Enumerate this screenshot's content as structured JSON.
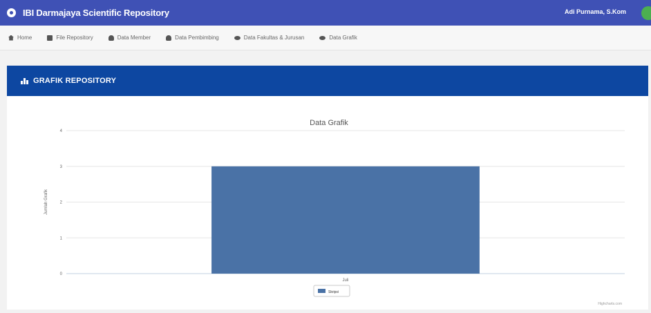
{
  "header": {
    "app_title": "IBI Darmajaya Scientific Repository",
    "user_name": "Adi Purnama, S.Kom"
  },
  "nav": {
    "items": [
      {
        "label": "Home",
        "icon": "home-icon"
      },
      {
        "label": "File Repository",
        "icon": "file-icon"
      },
      {
        "label": "Data Member",
        "icon": "user-icon"
      },
      {
        "label": "Data Pembimbing",
        "icon": "user-icon"
      },
      {
        "label": "Data Fakultas & Jurusan",
        "icon": "eye-icon"
      },
      {
        "label": "Data Grafik",
        "icon": "eye-icon"
      }
    ]
  },
  "panel": {
    "title": "GRAFIK REPOSITORY"
  },
  "chart_data": {
    "type": "bar",
    "title": "Data Grafik",
    "ylabel": "Jumlah Grafik",
    "xlabel": "",
    "categories": [
      "Juli"
    ],
    "series": [
      {
        "name": "Skripsi",
        "values": [
          3
        ],
        "color": "#4a72a6"
      }
    ],
    "ylim": [
      0,
      4
    ],
    "yticks": [
      0,
      1,
      2,
      3,
      4
    ],
    "grid": true,
    "legend": "bottom",
    "credit": "Highcharts.com"
  }
}
